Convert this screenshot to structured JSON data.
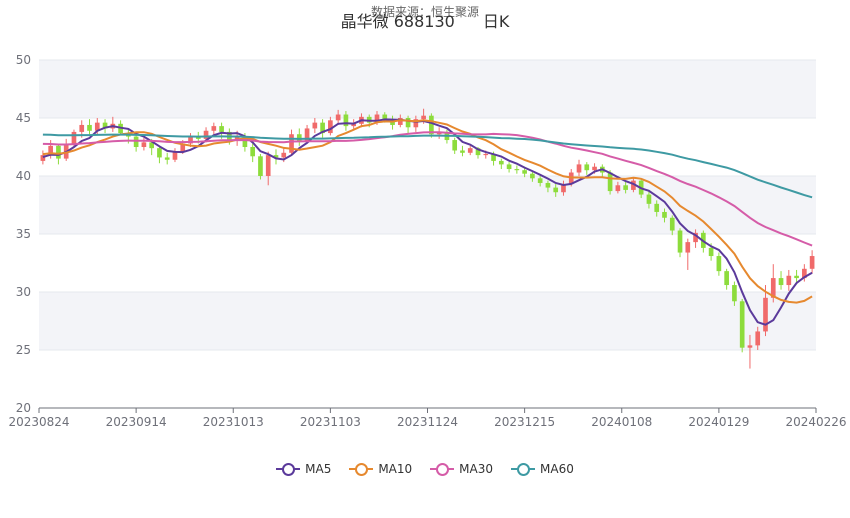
{
  "chart_data": {
    "type": "candlestick",
    "title": "晶华微 688130",
    "period": "日K",
    "subtitle": "数据来源：恒生聚源",
    "ylim": [
      20,
      50
    ],
    "yticks": [
      20,
      25,
      30,
      35,
      40,
      45,
      50
    ],
    "xticks": [
      "20230824",
      "20230914",
      "20231013",
      "20231103",
      "20231124",
      "20231215",
      "20240108",
      "20240129",
      "20240226"
    ],
    "legend": [
      {
        "name": "MA5",
        "color": "#5b3a9b"
      },
      {
        "name": "MA10",
        "color": "#e6892f"
      },
      {
        "name": "MA30",
        "color": "#d55ca8"
      },
      {
        "name": "MA60",
        "color": "#3e9aa3"
      }
    ],
    "up_color": "#f06a6a",
    "down_color": "#8ddc3c",
    "candles": [
      [
        41.3,
        41.8,
        41.0,
        42.2
      ],
      [
        41.8,
        42.6,
        41.5,
        43.1
      ],
      [
        42.6,
        41.5,
        41.0,
        42.8
      ],
      [
        41.5,
        42.8,
        41.3,
        43.2
      ],
      [
        42.8,
        43.8,
        42.5,
        44.0
      ],
      [
        43.8,
        44.4,
        43.3,
        44.8
      ],
      [
        44.4,
        43.9,
        43.6,
        44.9
      ],
      [
        43.9,
        44.6,
        43.5,
        45.0
      ],
      [
        44.6,
        44.1,
        43.7,
        44.9
      ],
      [
        44.1,
        44.5,
        43.8,
        45.1
      ],
      [
        44.5,
        43.7,
        43.5,
        44.8
      ],
      [
        43.7,
        43.4,
        42.8,
        44.0
      ],
      [
        43.4,
        42.5,
        42.1,
        43.6
      ],
      [
        42.5,
        42.9,
        42.2,
        43.3
      ],
      [
        42.9,
        42.4,
        41.8,
        43.2
      ],
      [
        42.4,
        41.6,
        41.1,
        42.6
      ],
      [
        41.6,
        41.4,
        41.0,
        42.0
      ],
      [
        41.4,
        42.1,
        41.2,
        42.4
      ],
      [
        42.1,
        42.8,
        41.9,
        43.1
      ],
      [
        42.8,
        43.4,
        42.5,
        43.7
      ],
      [
        43.4,
        43.2,
        42.8,
        43.8
      ],
      [
        43.2,
        43.9,
        42.9,
        44.2
      ],
      [
        43.9,
        44.3,
        43.6,
        44.6
      ],
      [
        44.3,
        43.8,
        43.2,
        44.6
      ],
      [
        43.8,
        43.1,
        42.7,
        44.1
      ],
      [
        43.1,
        43.4,
        42.6,
        43.9
      ],
      [
        43.4,
        42.5,
        42.1,
        43.7
      ],
      [
        42.5,
        41.7,
        41.2,
        42.8
      ],
      [
        41.7,
        40.0,
        39.7,
        41.9
      ],
      [
        40.0,
        41.8,
        39.2,
        42.1
      ],
      [
        41.8,
        41.6,
        41.0,
        42.3
      ],
      [
        41.6,
        42.0,
        41.2,
        42.4
      ],
      [
        42.0,
        43.6,
        41.8,
        44.0
      ],
      [
        43.6,
        43.0,
        42.6,
        44.1
      ],
      [
        43.0,
        44.1,
        42.8,
        44.4
      ],
      [
        44.1,
        44.6,
        43.7,
        45.0
      ],
      [
        44.6,
        43.7,
        43.3,
        44.9
      ],
      [
        43.7,
        44.8,
        43.5,
        45.1
      ],
      [
        44.8,
        45.3,
        44.4,
        45.7
      ],
      [
        45.3,
        44.3,
        43.9,
        45.6
      ],
      [
        44.3,
        44.5,
        44.0,
        44.9
      ],
      [
        44.5,
        45.1,
        44.2,
        45.4
      ],
      [
        45.1,
        44.6,
        44.2,
        45.3
      ],
      [
        44.6,
        45.3,
        44.4,
        45.6
      ],
      [
        45.3,
        44.9,
        44.6,
        45.5
      ],
      [
        44.9,
        44.4,
        44.0,
        45.2
      ],
      [
        44.4,
        45.0,
        44.2,
        45.3
      ],
      [
        45.0,
        44.2,
        43.6,
        45.2
      ],
      [
        44.2,
        44.9,
        43.8,
        45.2
      ],
      [
        44.9,
        45.2,
        44.5,
        45.8
      ],
      [
        45.2,
        43.6,
        43.3,
        45.4
      ],
      [
        43.6,
        43.8,
        43.2,
        44.2
      ],
      [
        43.8,
        43.1,
        42.8,
        44.0
      ],
      [
        43.1,
        42.2,
        41.9,
        43.3
      ],
      [
        42.2,
        42.0,
        41.7,
        42.6
      ],
      [
        42.0,
        42.4,
        41.8,
        42.6
      ],
      [
        42.4,
        41.8,
        41.5,
        42.5
      ],
      [
        41.8,
        41.9,
        41.5,
        42.2
      ],
      [
        41.9,
        41.3,
        40.9,
        42.1
      ],
      [
        41.3,
        41.0,
        40.6,
        41.5
      ],
      [
        41.0,
        40.6,
        40.3,
        41.2
      ],
      [
        40.6,
        40.5,
        40.2,
        40.9
      ],
      [
        40.5,
        40.2,
        39.9,
        40.8
      ],
      [
        40.2,
        39.8,
        39.5,
        40.4
      ],
      [
        39.8,
        39.4,
        39.1,
        40.0
      ],
      [
        39.4,
        39.0,
        38.6,
        39.6
      ],
      [
        39.0,
        38.6,
        38.2,
        39.3
      ],
      [
        38.6,
        39.3,
        38.3,
        39.6
      ],
      [
        39.3,
        40.3,
        39.1,
        40.6
      ],
      [
        40.3,
        41.0,
        40.0,
        41.4
      ],
      [
        41.0,
        40.5,
        40.1,
        41.2
      ],
      [
        40.5,
        40.8,
        40.2,
        41.1
      ],
      [
        40.8,
        40.3,
        39.9,
        41.0
      ],
      [
        40.3,
        38.7,
        38.4,
        40.5
      ],
      [
        38.7,
        39.2,
        38.5,
        39.5
      ],
      [
        39.2,
        38.8,
        38.5,
        39.5
      ],
      [
        38.8,
        39.6,
        38.6,
        39.9
      ],
      [
        39.6,
        38.4,
        38.1,
        39.8
      ],
      [
        38.4,
        37.6,
        37.2,
        38.7
      ],
      [
        37.6,
        36.9,
        36.5,
        37.9
      ],
      [
        36.9,
        36.4,
        36.0,
        37.2
      ],
      [
        36.4,
        35.3,
        34.9,
        36.6
      ],
      [
        35.3,
        33.4,
        33.0,
        35.5
      ],
      [
        33.4,
        34.3,
        31.9,
        34.6
      ],
      [
        34.3,
        35.1,
        33.8,
        35.4
      ],
      [
        35.1,
        33.8,
        33.4,
        35.3
      ],
      [
        33.8,
        33.1,
        32.7,
        34.2
      ],
      [
        33.1,
        31.8,
        31.4,
        33.4
      ],
      [
        31.8,
        30.6,
        30.2,
        32.0
      ],
      [
        30.6,
        29.2,
        28.8,
        30.9
      ],
      [
        29.2,
        25.2,
        24.8,
        29.4
      ],
      [
        25.2,
        25.4,
        23.4,
        26.3
      ],
      [
        25.4,
        26.6,
        25.0,
        27.0
      ],
      [
        26.6,
        29.5,
        26.2,
        30.6
      ],
      [
        29.5,
        31.2,
        29.1,
        32.4
      ],
      [
        31.2,
        30.6,
        30.2,
        31.8
      ],
      [
        30.6,
        31.4,
        30.1,
        31.9
      ],
      [
        31.4,
        31.2,
        30.8,
        31.9
      ],
      [
        31.2,
        32.0,
        30.9,
        32.4
      ],
      [
        32.0,
        33.1,
        31.6,
        33.6
      ]
    ]
  }
}
